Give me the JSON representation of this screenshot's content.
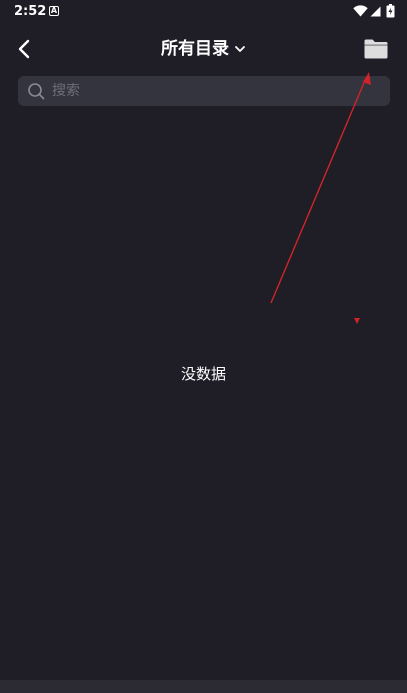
{
  "status_bar": {
    "time": "2:52",
    "notification_icon": "a-box-icon",
    "wifi_icon": "wifi-icon",
    "signal_icon": "signal-icon",
    "battery_icon": "battery-icon"
  },
  "header": {
    "back_icon": "chevron-left-icon",
    "title": "所有目录",
    "title_dropdown_icon": "chevron-down-icon",
    "folder_icon": "folder-icon"
  },
  "search": {
    "icon": "search-icon",
    "placeholder": "搜索",
    "value": ""
  },
  "main": {
    "empty_text": "没数据"
  },
  "colors": {
    "background": "#1f1e26",
    "search_bg": "#34343f",
    "placeholder": "#6e6e7a",
    "text": "#ffffff",
    "annotation": "#d2232a"
  }
}
